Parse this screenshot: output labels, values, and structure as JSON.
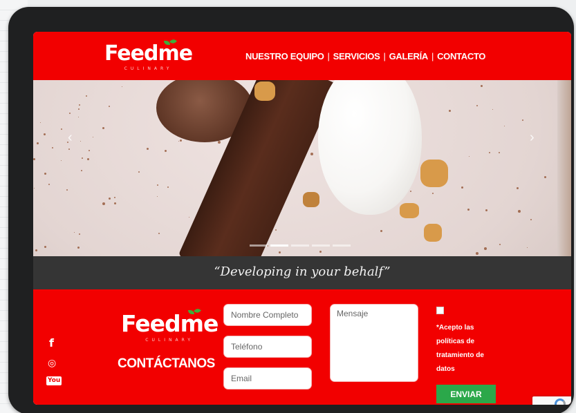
{
  "brand": {
    "name": "Feedme",
    "tagline_small": "CULINARY"
  },
  "nav": {
    "items": [
      "NUESTRO EQUIPO",
      "SERVICIOS",
      "GALERÍA",
      "CONTACTO"
    ],
    "separator": "|"
  },
  "hero": {
    "prev_icon": "chevron-left-icon",
    "next_icon": "chevron-right-icon",
    "slide_count": 5,
    "active_slide": 2
  },
  "tagline": "“Developing in your behalf”",
  "footer": {
    "title": "CONTÁCTANOS",
    "social": [
      {
        "icon": "facebook-icon",
        "glyph": "f"
      },
      {
        "icon": "instagram-icon",
        "glyph": "◎"
      },
      {
        "icon": "youtube-icon",
        "glyph": "You"
      }
    ],
    "form": {
      "name_placeholder": "Nombre Completo",
      "phone_placeholder": "Teléfono",
      "email_placeholder": "Email",
      "message_placeholder": "Mensaje",
      "policy_text": "*Acepto las políticas de tratamiento de datos",
      "submit_label": "ENVIAR"
    }
  },
  "colors": {
    "brand_red": "#f20000",
    "submit_green": "#2ba84a",
    "tagline_bar": "#353535",
    "tablet_frame": "#1f2021"
  }
}
